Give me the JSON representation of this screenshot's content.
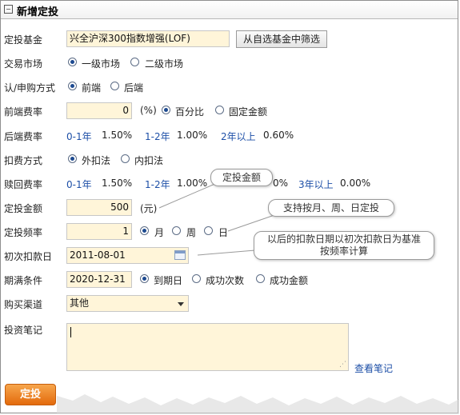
{
  "title": "新增定投",
  "labels": {
    "fund": "定投基金",
    "market": "交易市场",
    "buy_method": "认/申购方式",
    "front_fee": "前端费率",
    "back_fee": "后端费率",
    "deduct_method": "扣费方式",
    "redeem_fee": "赎回费率",
    "amount": "定投金额",
    "frequency": "定投频率",
    "first_date": "初次扣款日",
    "expire": "期满条件",
    "channel": "购买渠道",
    "notes": "投资笔记"
  },
  "fund_value": "兴全沪深300指数增强(LOF)",
  "select_fund_button": "从自选基金中筛选",
  "market_options": [
    "一级市场",
    "二级市场"
  ],
  "buy_options": [
    "前端",
    "后端"
  ],
  "front_fee_value": "0",
  "front_fee_unit": "(%)",
  "fee_type_options": [
    "百分比",
    "固定金额"
  ],
  "back_fee_rates": [
    {
      "period": "0-1年",
      "rate": "1.50%"
    },
    {
      "period": "1-2年",
      "rate": "1.00%"
    },
    {
      "period": "2年以上",
      "rate": "0.60%"
    }
  ],
  "deduct_options": [
    "外扣法",
    "内扣法"
  ],
  "redeem_rates": [
    {
      "period": "0-1年",
      "rate": "1.50%"
    },
    {
      "period": "1-2年",
      "rate": "1.00%"
    },
    {
      "partial": "0%"
    },
    {
      "period": "3年以上",
      "rate": "0.00%"
    }
  ],
  "amount_value": "500",
  "amount_unit": "(元)",
  "frequency_value": "1",
  "frequency_options": [
    "月",
    "周",
    "日"
  ],
  "first_date_value": "2011-08-01",
  "expire_value": "2020-12-31",
  "expire_options": [
    "到期日",
    "成功次数",
    "成功金额"
  ],
  "channel_value": "其他",
  "view_notes_link": "查看笔记",
  "submit_button": "定投",
  "callouts": {
    "amount": "定投金额",
    "frequency": "支持按月、周、日定投",
    "date": "以后的扣款日期以初次扣款日为基准按频率计算"
  }
}
